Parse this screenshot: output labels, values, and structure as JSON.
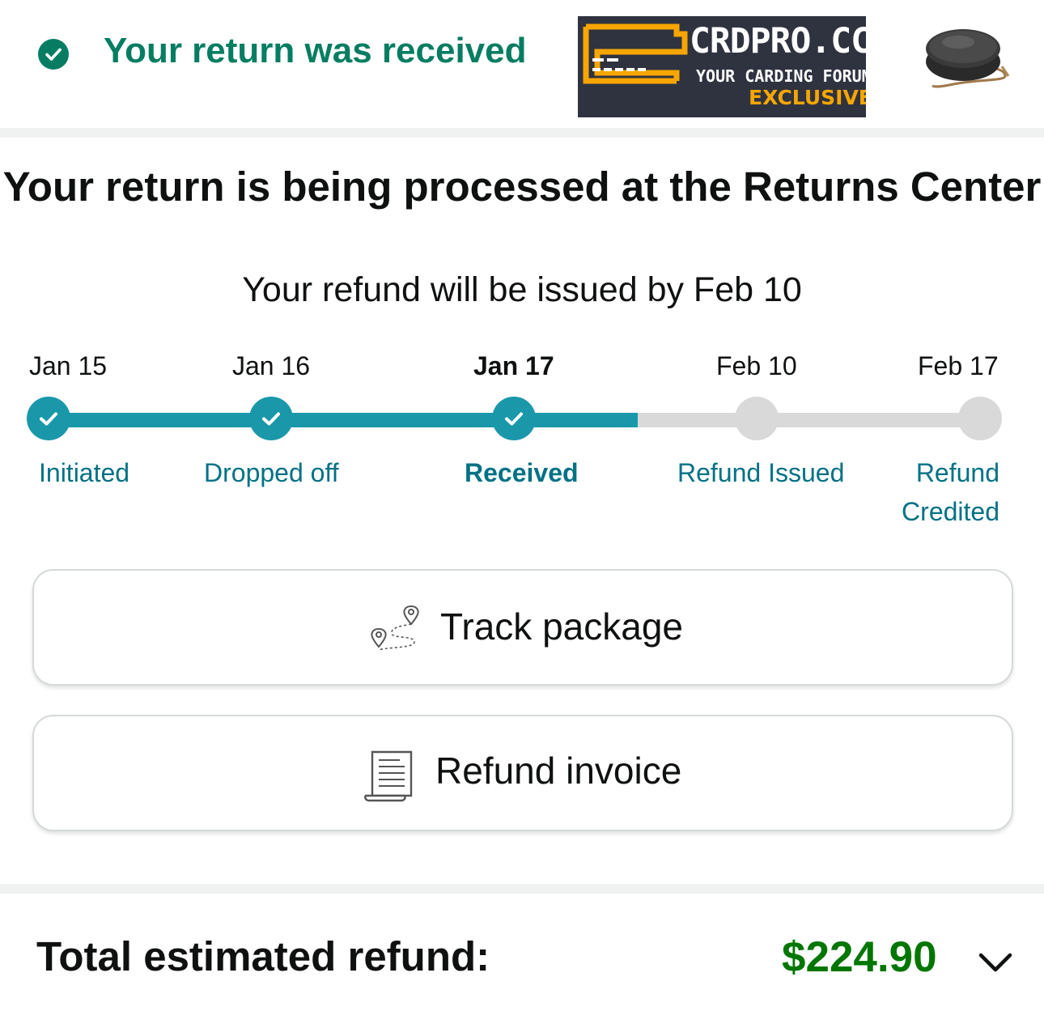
{
  "header": {
    "title": "Your return was received",
    "accent_color": "#067d62",
    "status_icon": "check-circle-icon"
  },
  "ad_banner": {
    "main_text": "CRDPRO.CC",
    "sub_text": "YOUR CARDING FORUM",
    "tag_text": "EXCLUSIVE",
    "background_color": "#2f3340",
    "accent_color": "#f7a600"
  },
  "product": {
    "thumbnail_icon": "speaker-icon"
  },
  "status": {
    "title": "Your return is being processed at the Returns Center",
    "subtitle": "Your refund will be issued by Feb 10"
  },
  "timeline": {
    "progress_color": "#1a98aa",
    "pending_color": "#d9d9d9",
    "steps": [
      {
        "date": "Jan 15",
        "label": "Initiated",
        "completed": true,
        "current": false
      },
      {
        "date": "Jan 16",
        "label": "Dropped off",
        "completed": true,
        "current": false
      },
      {
        "date": "Jan 17",
        "label": "Received",
        "completed": true,
        "current": true
      },
      {
        "date": "Feb 10",
        "label": "Refund Issued",
        "completed": false,
        "current": false
      },
      {
        "date": "Feb 17",
        "label_line1": "Refund",
        "label_line2": "Credited",
        "completed": false,
        "current": false
      }
    ]
  },
  "actions": {
    "track": {
      "label": "Track package",
      "icon": "route-map-pin-icon"
    },
    "invoice": {
      "label": "Refund invoice",
      "icon": "receipt-icon"
    }
  },
  "refund": {
    "label": "Total estimated refund:",
    "amount": "$224.90",
    "amount_color": "#007600",
    "expand_icon": "chevron-down-icon"
  }
}
